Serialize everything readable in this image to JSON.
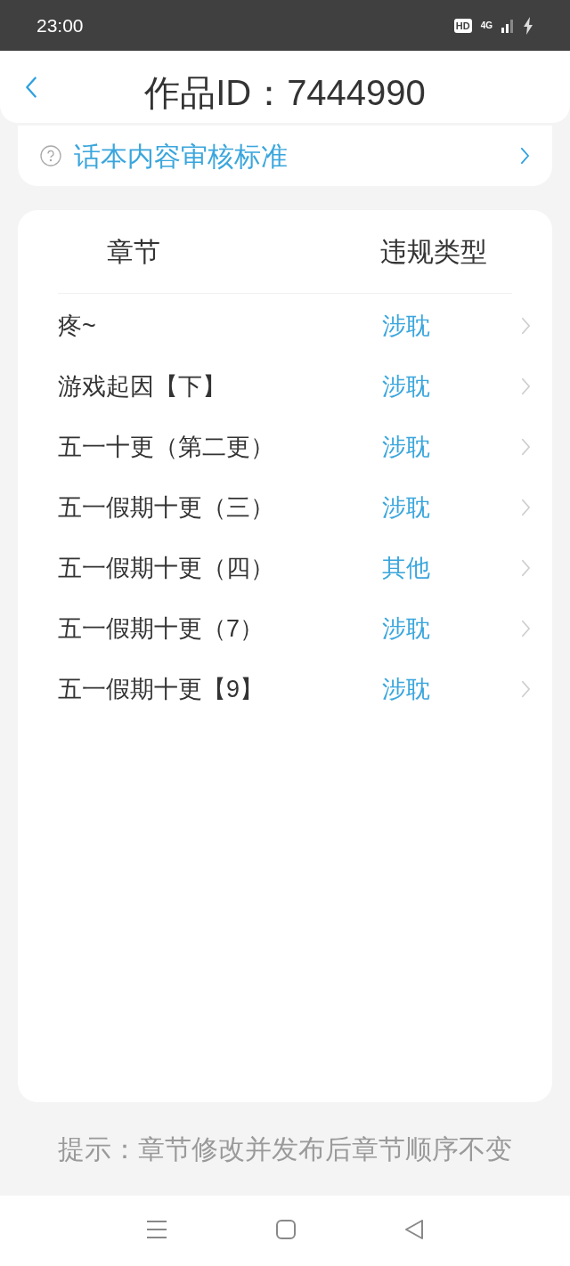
{
  "status_bar": {
    "time": "23:00",
    "hd_badge": "HD",
    "network": "4G"
  },
  "header": {
    "title": "作品ID：7444990"
  },
  "guideline_link": {
    "label": "话本内容审核标准"
  },
  "table": {
    "columns": [
      "章节",
      "违规类型"
    ],
    "rows": [
      {
        "chapter": "疼~",
        "violation": "涉耽"
      },
      {
        "chapter": "游戏起因【下】",
        "violation": "涉耽"
      },
      {
        "chapter": "五一十更（第二更）",
        "violation": "涉耽"
      },
      {
        "chapter": "五一假期十更（三）",
        "violation": "涉耽"
      },
      {
        "chapter": "五一假期十更（四）",
        "violation": "其他"
      },
      {
        "chapter": "五一假期十更（7）",
        "violation": "涉耽"
      },
      {
        "chapter": "五一假期十更【9】",
        "violation": "涉耽"
      }
    ]
  },
  "hint": "提示：章节修改并发布后章节顺序不变"
}
